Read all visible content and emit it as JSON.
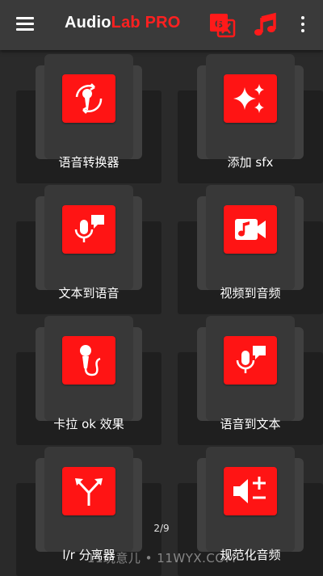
{
  "appbar": {
    "title_part1": "Audio",
    "title_part2": "Lab PRO",
    "translate_icon": "translate-icon",
    "music_icon": "music-note-icon",
    "menu_icon": "hamburger-menu-icon",
    "more_icon": "more-vert-icon"
  },
  "colors": {
    "accent": "#ff1414",
    "appbar": "#3a3a3a",
    "background": "#2a2a2a"
  },
  "tiles": [
    {
      "label": "语音转换器",
      "icon": "voice-changer-icon"
    },
    {
      "label": "添加 sfx",
      "icon": "sparkles-icon"
    },
    {
      "label": "文本到语音",
      "icon": "text-to-speech-icon"
    },
    {
      "label": "视频到音频",
      "icon": "video-to-audio-icon"
    },
    {
      "label": "卡拉 ok 效果",
      "icon": "karaoke-mic-icon"
    },
    {
      "label": "语音到文本",
      "icon": "speech-to-text-icon"
    },
    {
      "label": "l/r 分离器",
      "icon": "split-arrows-icon"
    },
    {
      "label": "规范化音频",
      "icon": "volume-normalize-icon"
    }
  ],
  "page_indicator": "2/9",
  "watermark": "11玩意儿 • 11WYX.COM"
}
